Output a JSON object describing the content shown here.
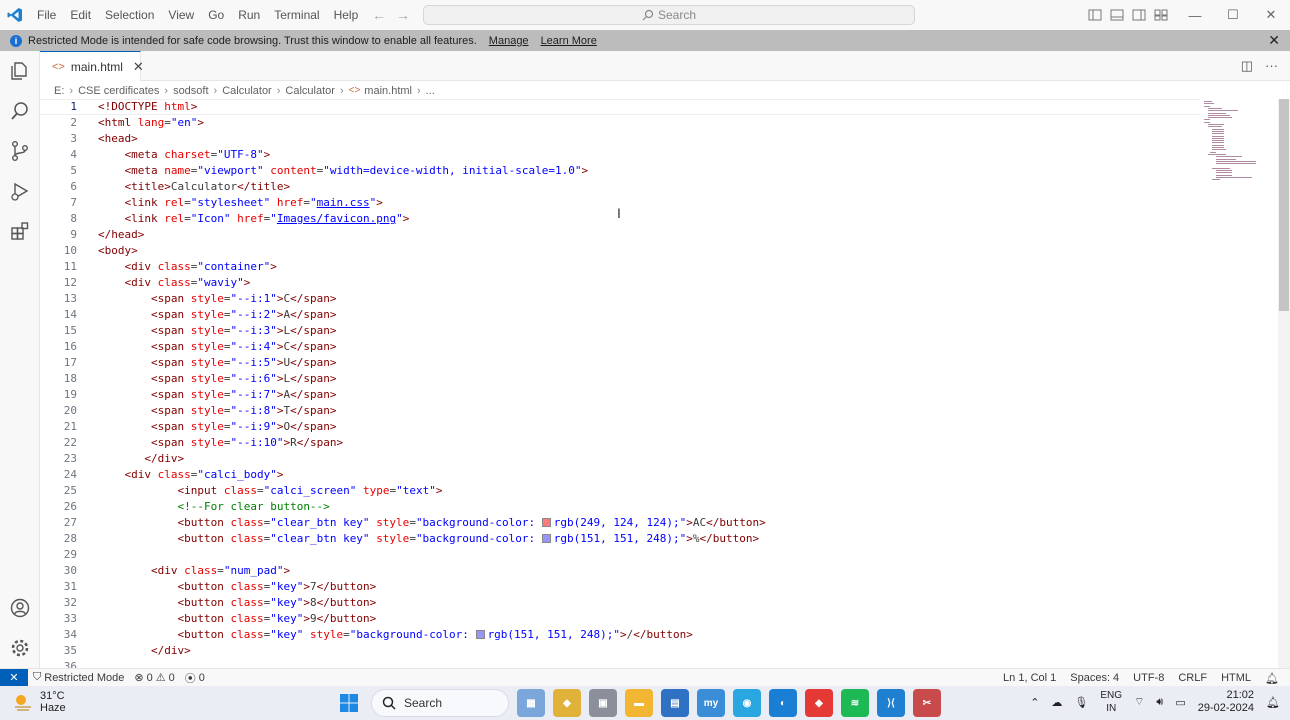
{
  "titlebar": {
    "menu": [
      "File",
      "Edit",
      "Selection",
      "View",
      "Go",
      "Run",
      "Terminal",
      "Help"
    ],
    "search_placeholder": "Search"
  },
  "banner": {
    "message": "Restricted Mode is intended for safe code browsing. Trust this window to enable all features.",
    "manage": "Manage",
    "learn_more": "Learn More"
  },
  "tab": {
    "label": "main.html"
  },
  "breadcrumb": [
    "E:",
    "CSE cerdificates",
    "sodsoft",
    "Calculator",
    "Calculator",
    "main.html",
    "..."
  ],
  "editor": {
    "line_numbers": [
      "1",
      "2",
      "3",
      "4",
      "5",
      "6",
      "7",
      "8",
      "9",
      "10",
      "11",
      "12",
      "13",
      "14",
      "15",
      "16",
      "17",
      "18",
      "19",
      "20",
      "21",
      "22",
      "23",
      "24",
      "25",
      "26",
      "27",
      "28",
      "29",
      "30",
      "31",
      "32",
      "33",
      "34",
      "35",
      "36"
    ],
    "swatch_colors": {
      "red": "#f97c7c",
      "purple": "#9797f8"
    }
  },
  "statusbar": {
    "restricted": "Restricted Mode",
    "errors": "0",
    "warnings": "0",
    "ports": "0",
    "position": "Ln 1, Col 1",
    "spaces": "Spaces: 4",
    "encoding": "UTF-8",
    "eol": "CRLF",
    "language": "HTML"
  },
  "taskbar": {
    "temp": "31°C",
    "weather": "Haze",
    "search": "Search",
    "lang1": "ENG",
    "lang2": "IN",
    "time": "21:02",
    "date": "29-02-2024"
  }
}
